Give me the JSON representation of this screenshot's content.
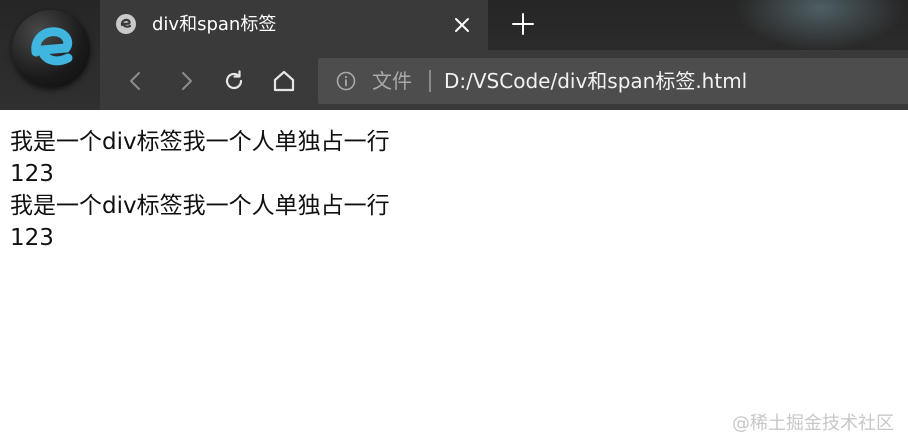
{
  "browser": {
    "tab": {
      "title": "div和span标签",
      "favicon": "edge-legacy-e-icon"
    },
    "toolbar": {
      "back_icon": "chevron-left-icon",
      "forward_icon": "chevron-right-icon",
      "reload_icon": "reload-icon",
      "home_icon": "home-icon"
    },
    "address_bar": {
      "security_label": "文件",
      "url": "D:/VSCode/div和span标签.html"
    },
    "colors": {
      "chrome": "#2b2b2b",
      "tab_active": "#3a3a3a",
      "address_bg": "#4d4d4d",
      "logo_accent": "#3fb6e0"
    }
  },
  "page": {
    "lines": [
      "我是一个div标签我一个人单独占一行",
      "123",
      "我是一个div标签我一个人单独占一行",
      "123"
    ]
  },
  "watermark": "@稀土掘金技术社区"
}
